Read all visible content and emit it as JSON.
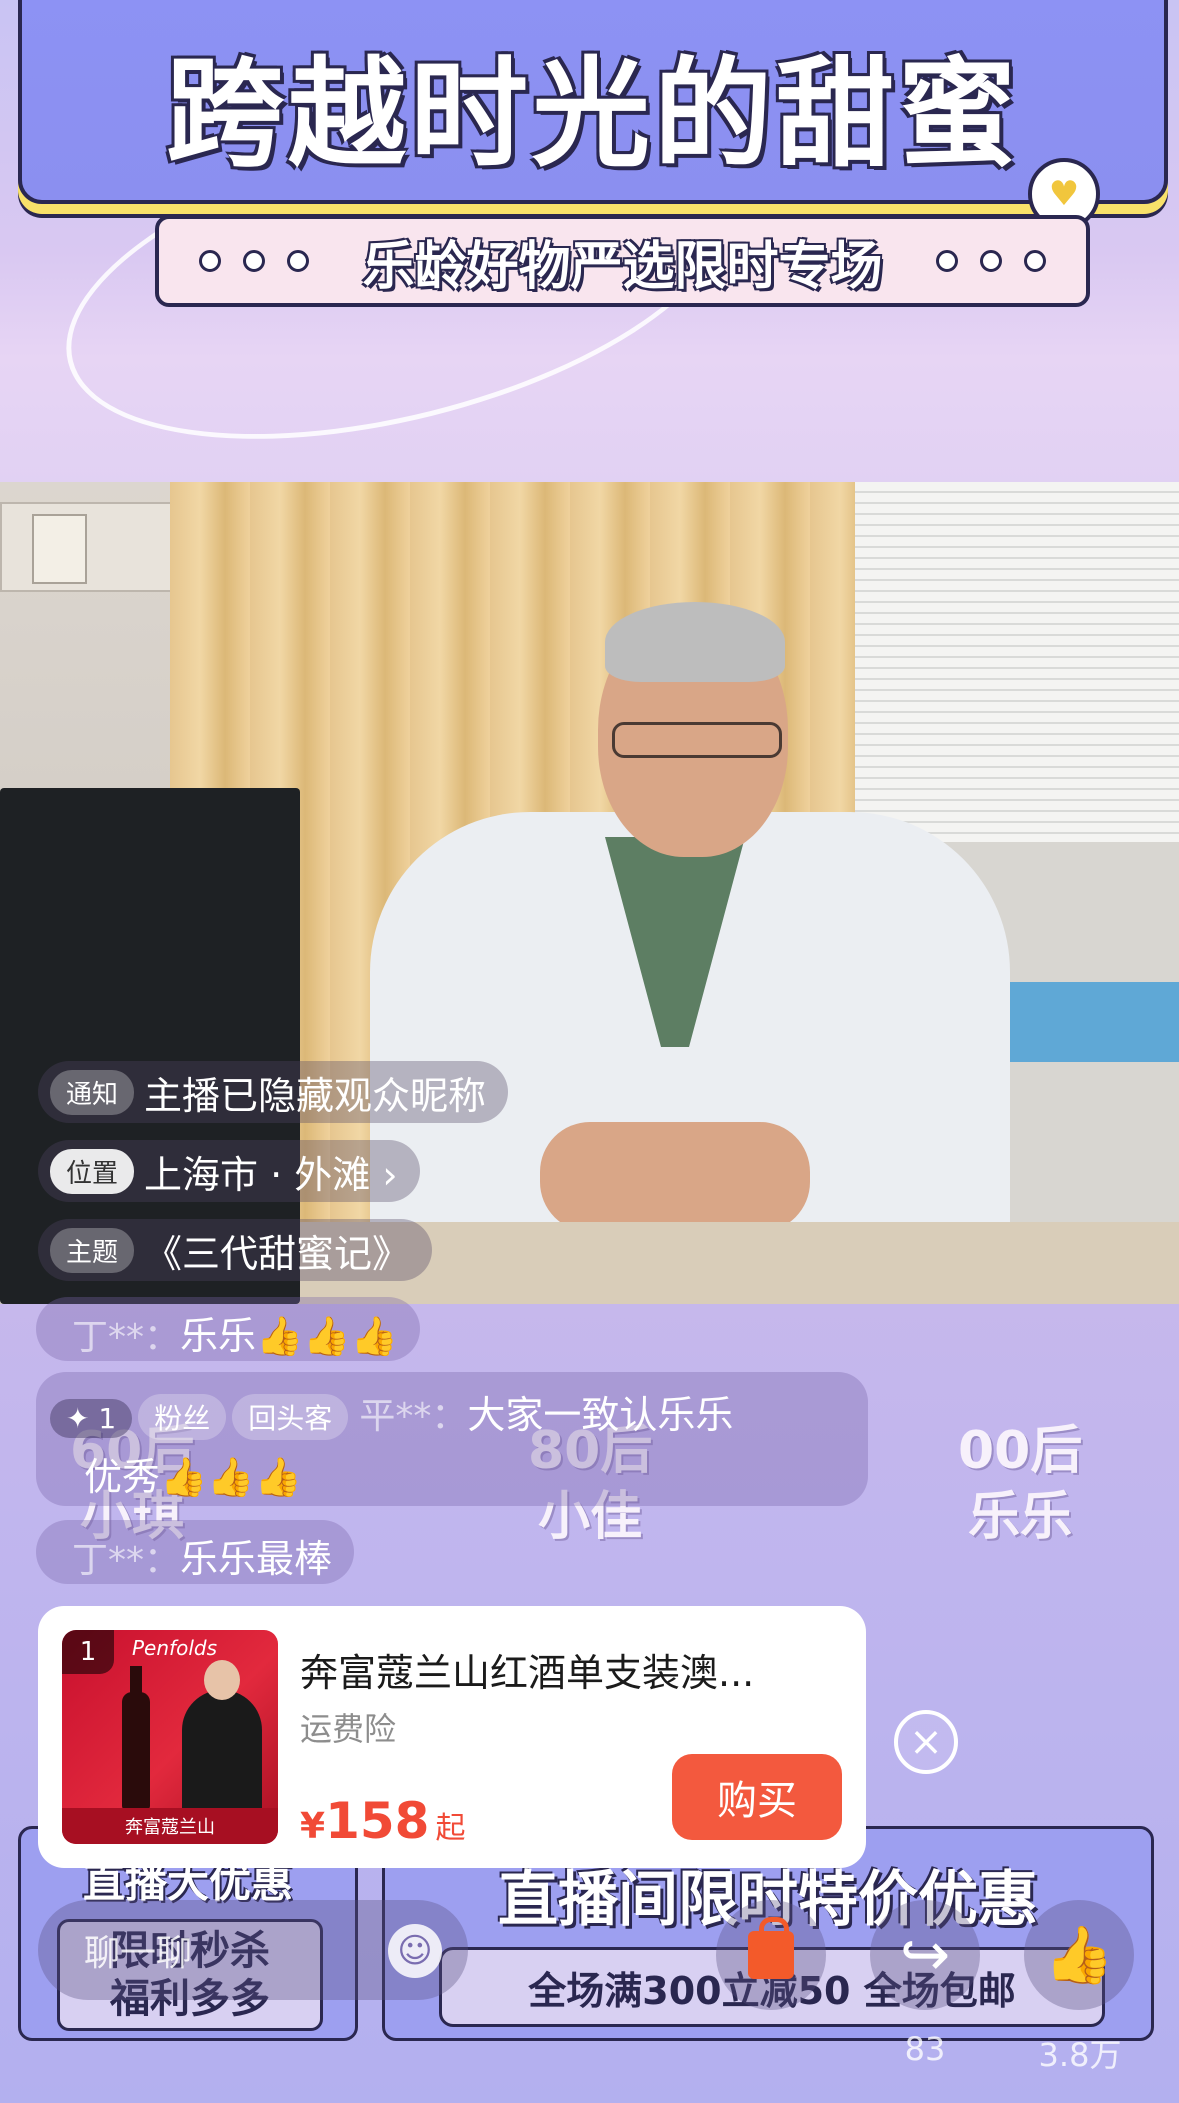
{
  "banner": {
    "title": "跨越时光的甜蜜",
    "subtitle": "乐龄好物严选限时专场"
  },
  "info": {
    "notice_tag": "通知",
    "notice_text": "主播已隐藏观众昵称",
    "location_tag": "位置",
    "location_text": "上海市 · 外滩 ›",
    "topic_tag": "主题",
    "topic_text": "《三代甜蜜记》"
  },
  "comments": [
    {
      "user": "丁**：",
      "text": "乐乐",
      "thumbs": "👍👍👍"
    },
    {
      "plus": "✦ 1",
      "badge1": "粉丝",
      "badge2": "回头客",
      "user": "平**：",
      "text": "大家一致认乐乐",
      "text2": "优秀",
      "thumbs": "👍👍👍"
    },
    {
      "user": "丁**：",
      "text": "乐乐最棒"
    }
  ],
  "generations": [
    {
      "era": "60后",
      "name": "小琪"
    },
    {
      "era": "80后",
      "name": "小佳"
    },
    {
      "era": "00后",
      "name": "乐乐"
    }
  ],
  "product": {
    "index": "1",
    "brand": "Penfolds",
    "thumb_caption": "奔富蔻兰山",
    "title": "奔富蔻兰山红酒单支装澳...",
    "tag": "运费险",
    "currency": "¥",
    "price": "158",
    "price_suffix": "起",
    "buy_label": "购买"
  },
  "promo": {
    "left_head": "直播大优惠",
    "left_line1": "限时秒杀",
    "left_line2": "福利多多",
    "right_head": "直播间限时特价优惠",
    "right_box": "全场满300立减50  全场包邮"
  },
  "toolbar": {
    "chat_placeholder": "聊一聊",
    "share_count": "83",
    "like_count": "3.8万"
  },
  "icons": {
    "heart": "heart-icon",
    "close": "close-icon",
    "emoji": "emoji-icon",
    "bag": "shopping-bag-icon",
    "share": "share-icon",
    "like": "thumbs-up-icon"
  },
  "colors": {
    "accent_price": "#f14a36",
    "buy_button": "#f3593e",
    "banner_blue": "#8d92f4",
    "banner_yellow": "#f8e16a"
  }
}
